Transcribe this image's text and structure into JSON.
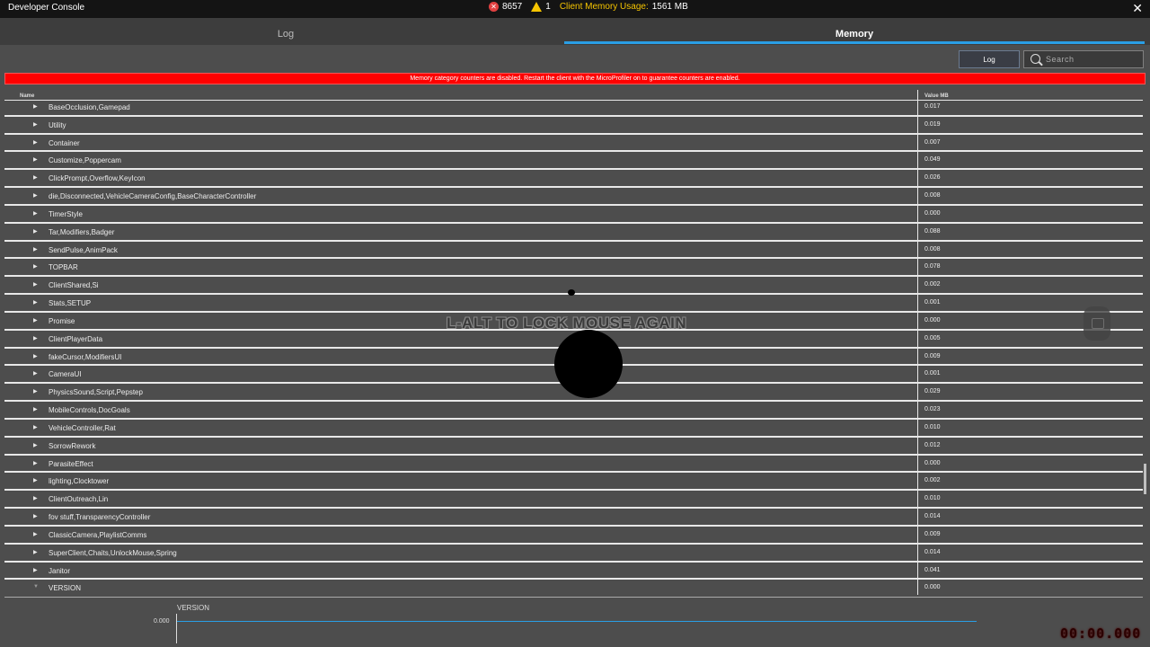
{
  "window": {
    "title": "Developer Console",
    "error_count": "8657",
    "warning_count": "1",
    "memory_label": "Client Memory Usage:",
    "memory_value": "1561 MB",
    "close_glyph": "✕"
  },
  "tabs": [
    {
      "label": "Log",
      "active": false
    },
    {
      "label": "Memory",
      "active": true
    }
  ],
  "toolbar": {
    "log_button": "Log",
    "search_placeholder": "Search"
  },
  "banner": "Memory category counters are disabled. Restart the client with the MicroProfiler on to guarantee counters are enabled.",
  "table": {
    "headers": {
      "name": "Name",
      "value": "Value MB"
    },
    "rows": [
      {
        "name": "BaseOcclusion,Gamepad",
        "value": "0.017"
      },
      {
        "name": "Utility",
        "value": "0.019"
      },
      {
        "name": "Container",
        "value": "0.007"
      },
      {
        "name": "Customize,Poppercam",
        "value": "0.049"
      },
      {
        "name": "ClickPrompt,Overflow,KeyIcon",
        "value": "0.026"
      },
      {
        "name": "die,Disconnected,VehicleCameraConfig,BaseCharacterController",
        "value": "0.008"
      },
      {
        "name": "TimerStyle",
        "value": "0.000"
      },
      {
        "name": "Tar,Modifiers,Badger",
        "value": "0.088"
      },
      {
        "name": "SendPulse,AnimPack",
        "value": "0.008"
      },
      {
        "name": "TOPBAR",
        "value": "0.078"
      },
      {
        "name": "ClientShared,Si",
        "value": "0.002"
      },
      {
        "name": "Stats,SETUP",
        "value": "0.001"
      },
      {
        "name": "Promise",
        "value": "0.000"
      },
      {
        "name": "ClientPlayerData",
        "value": "0.005"
      },
      {
        "name": "fakeCursor,ModifiersUI",
        "value": "0.009"
      },
      {
        "name": "CameraUI",
        "value": "0.001"
      },
      {
        "name": "PhysicsSound,Script,Pepstep",
        "value": "0.029"
      },
      {
        "name": "MobileControls,DocGoals",
        "value": "0.023"
      },
      {
        "name": "VehicleController,Rat",
        "value": "0.010"
      },
      {
        "name": "SorrowRework",
        "value": "0.012"
      },
      {
        "name": "ParasiteEffect",
        "value": "0.000"
      },
      {
        "name": "lighting,Clocktower",
        "value": "0.002"
      },
      {
        "name": "ClientOutreach,Lin",
        "value": "0.010"
      },
      {
        "name": "fov stuff,TransparencyController",
        "value": "0.014"
      },
      {
        "name": "ClassicCamera,PlaylistComms",
        "value": "0.009"
      },
      {
        "name": "SuperClient,Chaits,UnlockMouse,Spring",
        "value": "0.014"
      },
      {
        "name": "Janitor",
        "value": "0.041"
      },
      {
        "name": "VERSION",
        "value": "0.000",
        "expanded": true
      }
    ]
  },
  "graph": {
    "title": "VERSION",
    "y_value": "0.000"
  },
  "overlay": {
    "message": "L-ALT TO LOCK MOUSE AGAIN",
    "timer": "00:00.000"
  },
  "colors": {
    "accent": "#2a9ee5",
    "banner": "#ff0000",
    "warning": "#f5c400",
    "error": "#e04040"
  }
}
